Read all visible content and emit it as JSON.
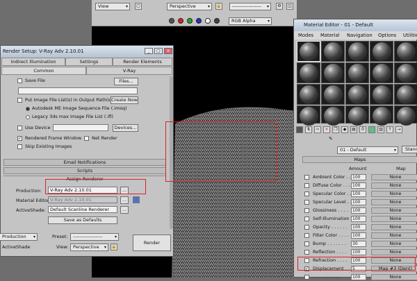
{
  "frame": {
    "view_dropdown": "View",
    "viewport_dropdown": "Perspective",
    "preset_dropdown": "------------------",
    "production_dropdown": "Production",
    "channel_dropdown": "RGB Alpha"
  },
  "render_setup": {
    "title": "Render Setup: V-Ray Adv 2.10.01",
    "tabs_row1": [
      "Indirect illumination",
      "Settings",
      "Render Elements"
    ],
    "tabs_row2": [
      "Common",
      "V-Ray"
    ],
    "save_file_label": "Save File",
    "files_button": "Files...",
    "put_image_label": "Put Image File List(s) in Output Path(s)",
    "create_now_button": "Create Now",
    "autodesk_option": "Autodesk ME Image Sequence File (.imsq)",
    "legacy_option": "Legacy 3ds max Image File List (.ifl)",
    "use_device_label": "Use Device",
    "devices_button": "Devices...",
    "rendered_frame_window_label": "Rendered Frame Window",
    "net_render_label": "Net Render",
    "skip_existing_label": "Skip Existing Images",
    "email_rollout": "Email Notifications",
    "scripts_rollout": "Scripts",
    "assign_renderer_rollout": "Assign Renderer",
    "production_label": "Production:",
    "production_value": "V-Ray Adv 2.10.01",
    "material_editor_label": "Material Editor:",
    "material_editor_value": "V-Ray Adv 2.10.01",
    "activeshade_label": "ActiveShade:",
    "activeshade_value": "Default Scanline Renderer",
    "browse_label": "...",
    "save_defaults_button": "Save as Defaults",
    "mode_dropdown": "Production",
    "preset_label": "Preset:",
    "preset_value": "------------------",
    "activeshade_bottom": "ActiveShade",
    "view_label": "View:",
    "view_value": "Perspective",
    "render_button": "Render"
  },
  "material_editor": {
    "title": "Material Editor - 01 - Default",
    "menu": [
      "Modes",
      "Material",
      "Navigation",
      "Options",
      "Utilities"
    ],
    "material_name": "01 - Default",
    "type_button": "Standard",
    "maps_rollout": "Maps",
    "amount_header": "Amount",
    "map_header": "Map",
    "maps": [
      {
        "name": "Ambient Color . . .",
        "amount": "100",
        "map": "None",
        "checked": false
      },
      {
        "name": "Diffuse Color . . .",
        "amount": "100",
        "map": "None",
        "checked": false
      },
      {
        "name": "Specular Color . . .",
        "amount": "100",
        "map": "None",
        "checked": false
      },
      {
        "name": "Specular Level . . .",
        "amount": "100",
        "map": "None",
        "checked": false
      },
      {
        "name": "Glossiness . . . .",
        "amount": "100",
        "map": "None",
        "checked": false
      },
      {
        "name": "Self-Illumination .",
        "amount": "100",
        "map": "None",
        "checked": false
      },
      {
        "name": "Opacity . . . . . .",
        "amount": "100",
        "map": "None",
        "checked": false
      },
      {
        "name": "Filter Color . . . .",
        "amount": "100",
        "map": "None",
        "checked": false
      },
      {
        "name": "Bump . . . . . . .",
        "amount": "30",
        "map": "None",
        "checked": false
      },
      {
        "name": "Reflection . . . .",
        "amount": "100",
        "map": "None",
        "checked": false
      },
      {
        "name": "Refraction . . . .",
        "amount": "100",
        "map": "None",
        "checked": false
      },
      {
        "name": "Displacement . . .",
        "amount": "5",
        "map": "Map #3 (Dent)",
        "checked": true
      },
      {
        "name": ". . . . . . . . . .",
        "amount": "100",
        "map": "None",
        "checked": false
      }
    ]
  },
  "colors": {
    "highlight": "#e02020",
    "titlebar": "#c8d4e2"
  }
}
